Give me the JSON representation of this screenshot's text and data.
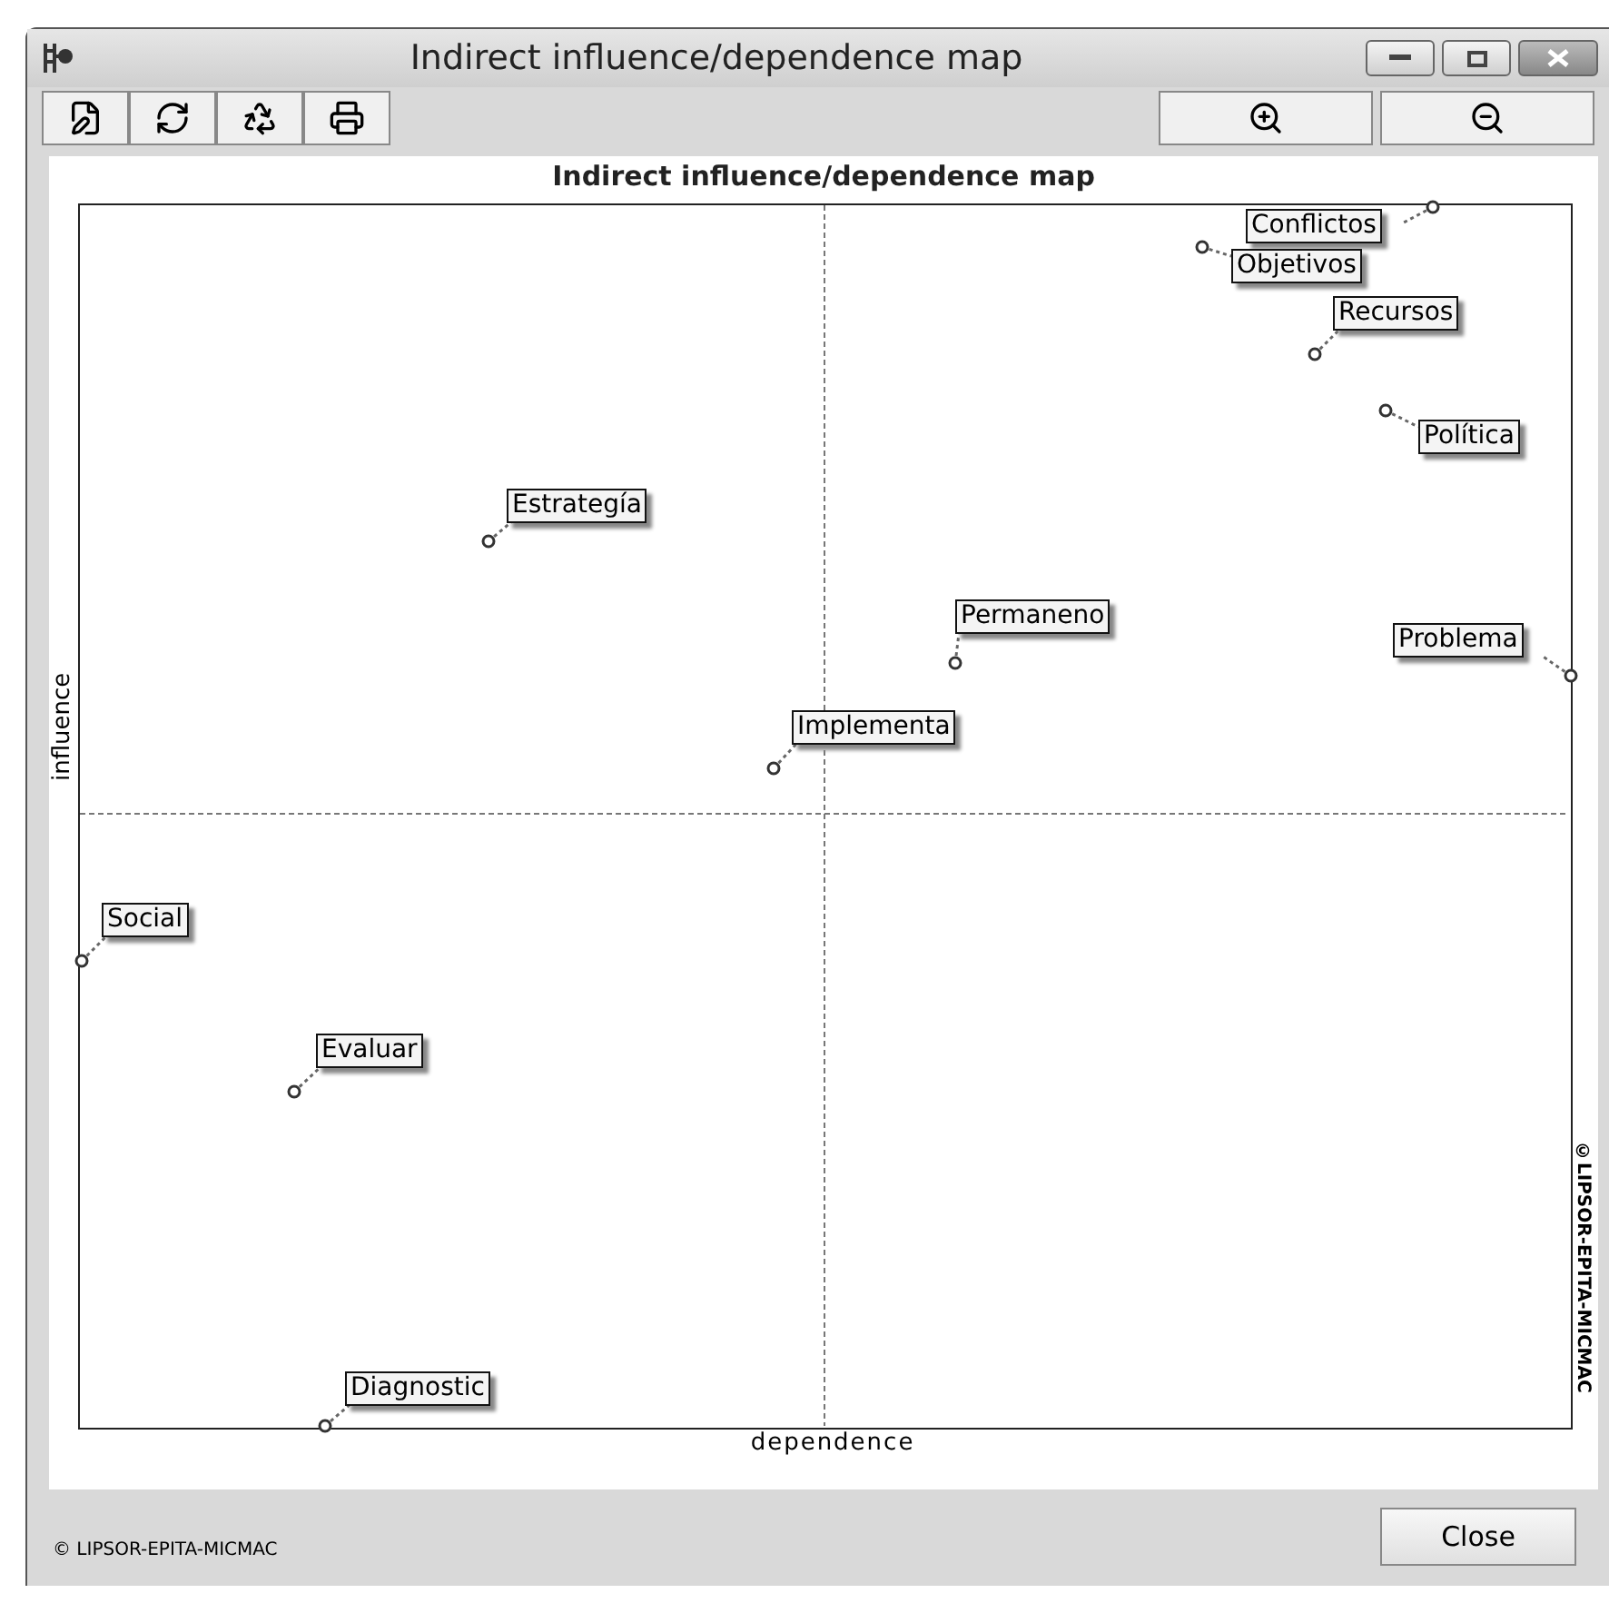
{
  "window": {
    "title": "Indirect influence/dependence map"
  },
  "chart": {
    "title": "Indirect influence/dependence map",
    "xlabel": "dependence",
    "ylabel": "influence",
    "watermark": "©LIPSOR-EPITA-MICMAC",
    "points": [
      {
        "label": "Conflictos"
      },
      {
        "label": "Objetivos"
      },
      {
        "label": "Recursos"
      },
      {
        "label": "Política"
      },
      {
        "label": "Problema"
      },
      {
        "label": "Estrategía"
      },
      {
        "label": "Permaneno"
      },
      {
        "label": "Implementa"
      },
      {
        "label": "Social"
      },
      {
        "label": "Evaluar"
      },
      {
        "label": "Diagnostic"
      }
    ]
  },
  "footer": {
    "copyright": "© LIPSOR-EPITA-MICMAC",
    "button": "Close"
  }
}
